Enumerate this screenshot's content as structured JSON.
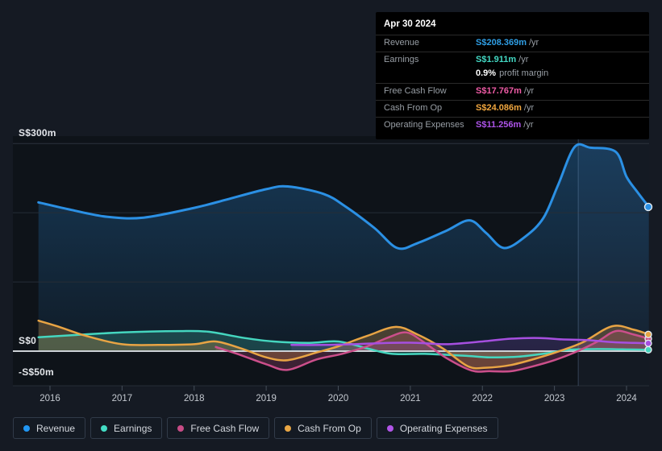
{
  "tooltip": {
    "date": "Apr 30 2024",
    "rows": [
      {
        "label": "Revenue",
        "value": "S$208.369m",
        "unit": "/yr",
        "color": "#2f9fe6"
      },
      {
        "label": "Earnings",
        "value": "S$1.911m",
        "unit": "/yr",
        "color": "#43d9c4"
      },
      {
        "label": "Free Cash Flow",
        "value": "S$17.767m",
        "unit": "/yr",
        "color": "#ee5ba5"
      },
      {
        "label": "Cash From Op",
        "value": "S$24.086m",
        "unit": "/yr",
        "color": "#f0a63f"
      },
      {
        "label": "Operating Expenses",
        "value": "S$11.256m",
        "unit": "/yr",
        "color": "#ae54ea"
      }
    ],
    "profit_margin": {
      "value": "0.9%",
      "label": "profit margin"
    }
  },
  "axis": {
    "y300": "S$300m",
    "y0": "S$0",
    "yneg50": "-S$50m"
  },
  "legend": {
    "items": [
      {
        "label": "Revenue",
        "color": "#2196f3"
      },
      {
        "label": "Earnings",
        "color": "#43dcc4"
      },
      {
        "label": "Free Cash Flow",
        "color": "#c74c86"
      },
      {
        "label": "Cash From Op",
        "color": "#e9a644"
      },
      {
        "label": "Operating Expenses",
        "color": "#b155e8"
      }
    ]
  },
  "chart_data": {
    "type": "area",
    "currency_unit": "S$ millions",
    "x_ticks": [
      2016,
      2017,
      2018,
      2019,
      2020,
      2021,
      2022,
      2023,
      2024
    ],
    "x_range": [
      2015.84,
      2024.33
    ],
    "y_gridlines": [
      300,
      200,
      100,
      0,
      -50
    ],
    "ylim": [
      -50,
      300
    ],
    "legend_position": "bottom",
    "crosshair_year": 2023.33,
    "series": [
      {
        "name": "Revenue",
        "color": "#2b90e4",
        "line_width": 3,
        "fill": "gradient",
        "points": [
          [
            2015.84,
            215
          ],
          [
            2016.3,
            204
          ],
          [
            2016.8,
            194
          ],
          [
            2017.3,
            193
          ],
          [
            2018.0,
            207
          ],
          [
            2018.45,
            219
          ],
          [
            2019.0,
            234
          ],
          [
            2019.3,
            238
          ],
          [
            2019.8,
            227
          ],
          [
            2020.1,
            209
          ],
          [
            2020.5,
            178
          ],
          [
            2020.82,
            149
          ],
          [
            2021.1,
            156
          ],
          [
            2021.5,
            174
          ],
          [
            2021.82,
            189
          ],
          [
            2022.05,
            171
          ],
          [
            2022.3,
            149
          ],
          [
            2022.6,
            166
          ],
          [
            2022.85,
            193
          ],
          [
            2023.05,
            240
          ],
          [
            2023.28,
            295
          ],
          [
            2023.5,
            294
          ],
          [
            2023.85,
            288
          ],
          [
            2024.0,
            252
          ],
          [
            2024.15,
            230
          ],
          [
            2024.31,
            208.369
          ]
        ]
      },
      {
        "name": "Earnings",
        "color": "#45d6bf",
        "line_width": 2.5,
        "fill_opacity": 0.22,
        "points": [
          [
            2015.84,
            20
          ],
          [
            2016.3,
            23
          ],
          [
            2017.0,
            27
          ],
          [
            2017.8,
            29
          ],
          [
            2018.2,
            28
          ],
          [
            2018.7,
            19
          ],
          [
            2019.1,
            14
          ],
          [
            2019.6,
            12
          ],
          [
            2020.0,
            14
          ],
          [
            2020.4,
            4
          ],
          [
            2020.75,
            -4
          ],
          [
            2021.2,
            -4
          ],
          [
            2021.8,
            -7
          ],
          [
            2022.1,
            -9
          ],
          [
            2022.5,
            -8
          ],
          [
            2022.9,
            -3
          ],
          [
            2023.2,
            2
          ],
          [
            2023.6,
            3
          ],
          [
            2024.0,
            2.5
          ],
          [
            2024.31,
            1.911
          ]
        ]
      },
      {
        "name": "Free Cash Flow",
        "color": "#cc4f8b",
        "line_width": 2.5,
        "fill_opacity": 0.25,
        "points": [
          [
            2018.3,
            6
          ],
          [
            2018.6,
            -4
          ],
          [
            2019.0,
            -19
          ],
          [
            2019.3,
            -27
          ],
          [
            2019.7,
            -12
          ],
          [
            2020.05,
            -4
          ],
          [
            2020.4,
            7
          ],
          [
            2020.7,
            20
          ],
          [
            2020.95,
            27
          ],
          [
            2021.2,
            12
          ],
          [
            2021.5,
            -10
          ],
          [
            2021.85,
            -28
          ],
          [
            2022.1,
            -29
          ],
          [
            2022.4,
            -29
          ],
          [
            2022.7,
            -22
          ],
          [
            2023.0,
            -13
          ],
          [
            2023.3,
            -1
          ],
          [
            2023.6,
            14
          ],
          [
            2023.85,
            29
          ],
          [
            2024.1,
            24
          ],
          [
            2024.31,
            17.767
          ]
        ]
      },
      {
        "name": "Cash From Op",
        "color": "#e8a444",
        "line_width": 2.5,
        "fill_opacity": 0.26,
        "points": [
          [
            2015.84,
            44
          ],
          [
            2016.1,
            36
          ],
          [
            2016.5,
            22
          ],
          [
            2017.0,
            10
          ],
          [
            2017.5,
            9
          ],
          [
            2018.0,
            10
          ],
          [
            2018.3,
            14
          ],
          [
            2018.65,
            4
          ],
          [
            2019.0,
            -9
          ],
          [
            2019.3,
            -13
          ],
          [
            2019.7,
            -2
          ],
          [
            2020.0,
            7
          ],
          [
            2020.4,
            22
          ],
          [
            2020.8,
            35
          ],
          [
            2021.1,
            24
          ],
          [
            2021.45,
            4
          ],
          [
            2021.8,
            -22
          ],
          [
            2022.05,
            -24
          ],
          [
            2022.4,
            -20
          ],
          [
            2022.8,
            -9
          ],
          [
            2023.1,
            1
          ],
          [
            2023.4,
            13
          ],
          [
            2023.8,
            36
          ],
          [
            2024.1,
            31
          ],
          [
            2024.31,
            24.086
          ]
        ]
      },
      {
        "name": "Operating Expenses",
        "color": "#a64fe0",
        "line_width": 2.5,
        "fill_opacity": 0.16,
        "points": [
          [
            2019.35,
            9
          ],
          [
            2019.8,
            9
          ],
          [
            2020.2,
            10
          ],
          [
            2020.7,
            12
          ],
          [
            2021.1,
            12
          ],
          [
            2021.5,
            10
          ],
          [
            2022.0,
            14
          ],
          [
            2022.4,
            18
          ],
          [
            2022.8,
            19
          ],
          [
            2023.1,
            17
          ],
          [
            2023.45,
            16
          ],
          [
            2023.8,
            13
          ],
          [
            2024.1,
            12
          ],
          [
            2024.31,
            11.256
          ]
        ]
      }
    ]
  }
}
